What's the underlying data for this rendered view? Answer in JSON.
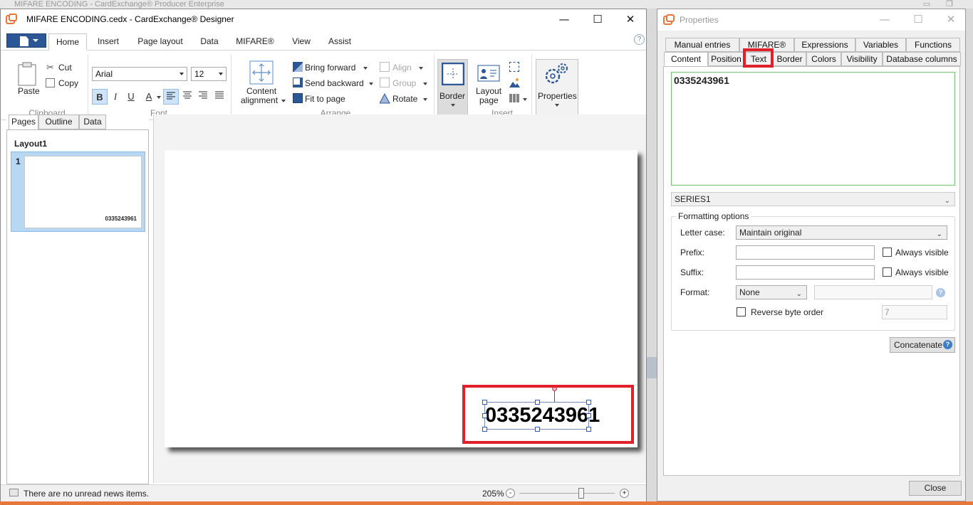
{
  "background_window": {
    "title": "MIFARE ENCODING - CardExchange® Producer Enterprise"
  },
  "designer": {
    "title": "MIFARE ENCODING.cedx - CardExchange® Designer",
    "window_buttons": {
      "minimize": "—",
      "maximize": "☐",
      "close": "✕"
    },
    "help": "?",
    "ribbon_tabs": [
      "Home",
      "Insert",
      "Page layout",
      "Data",
      "MIFARE®",
      "View",
      "Assist"
    ],
    "active_tab": "Home",
    "clipboard": {
      "paste": "Paste",
      "cut": "Cut",
      "copy": "Copy",
      "group_label": "Clipboard"
    },
    "font": {
      "family": "Arial",
      "size": "12",
      "group_label": "Font",
      "bold": "B",
      "italic": "I",
      "underline": "U",
      "color": "A"
    },
    "arrange": {
      "content_alignment_1": "Content",
      "content_alignment_2": "alignment",
      "bring_forward": "Bring forward",
      "send_backward": "Send backward",
      "fit_to_page": "Fit to page",
      "align": "Align",
      "group": "Group",
      "rotate": "Rotate",
      "group_label": "Arrange"
    },
    "insert": {
      "border": "Border",
      "layout_page_1": "Layout",
      "layout_page_2": "page",
      "group_label": "Insert"
    },
    "properties": {
      "label": "Properties"
    },
    "left_panel": {
      "tabs": [
        "Pages",
        "Outline",
        "Data"
      ],
      "active_tab": "Pages",
      "layout_title": "Layout1",
      "page_number": "1",
      "thumb_value": "0335243961"
    },
    "canvas": {
      "card_value": "0335243961"
    },
    "status": {
      "news": "There are no unread news items.",
      "zoom": "205%",
      "zoom_level_pct": 65,
      "minus": "-",
      "plus": "+"
    }
  },
  "properties": {
    "title": "Properties",
    "window_buttons": {
      "minimize": "—",
      "maximize": "☐",
      "close": "✕"
    },
    "tabs_row1": [
      "Manual entries",
      "MIFARE®",
      "Expressions",
      "Variables",
      "Functions"
    ],
    "tabs_row2": [
      "Content",
      "Position",
      "Text",
      "Border",
      "Colors",
      "Visibility",
      "Database columns"
    ],
    "active_tab": "Content",
    "highlighted_tab": "Text",
    "content_text": "0335243961",
    "source_field": "SERIES1",
    "formatting": {
      "legend": "Formatting options",
      "letter_case_label": "Letter case:",
      "letter_case_value": "Maintain original",
      "prefix_label": "Prefix:",
      "suffix_label": "Suffix:",
      "always_visible": "Always visible",
      "format_label": "Format:",
      "format_value": "None",
      "reverse_byte_order": "Reverse byte order",
      "reverse_value": "7"
    },
    "concatenate": "Concatenate",
    "close": "Close"
  },
  "colors": {
    "accent_red": "#e0202a",
    "file_blue": "#2b5797",
    "selection_blue": "#b7d7f3"
  }
}
